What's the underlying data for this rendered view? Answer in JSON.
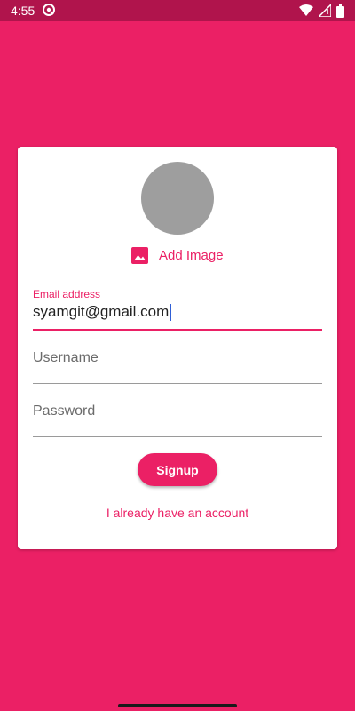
{
  "status_bar": {
    "time": "4:55",
    "icons": [
      "circle-a-icon",
      "wifi-icon",
      "signal-icon",
      "battery-icon"
    ]
  },
  "colors": {
    "accent": "#eb2065",
    "status_bar": "#b0144c",
    "avatar_placeholder": "#9e9e9e"
  },
  "card": {
    "add_image_label": "Add Image",
    "email": {
      "label": "Email address",
      "value": "syamgit@gmail.com"
    },
    "username": {
      "placeholder": "Username"
    },
    "password": {
      "placeholder": "Password"
    },
    "signup_label": "Signup",
    "login_link": "I already have an account"
  }
}
